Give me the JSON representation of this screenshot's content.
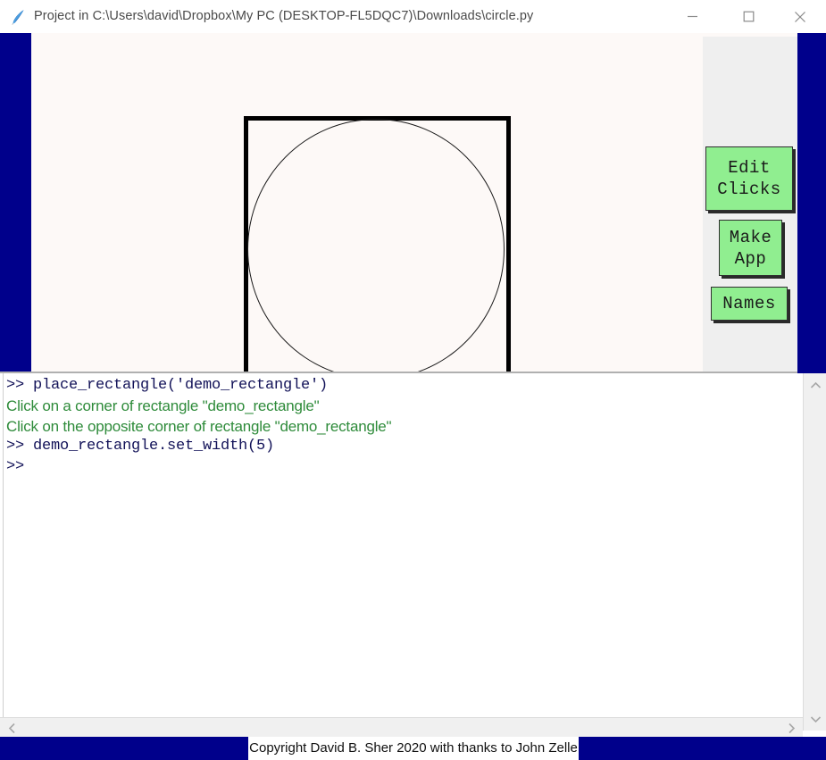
{
  "window": {
    "title": "Project in C:\\Users\\david\\Dropbox\\My PC (DESKTOP-FL5DQC7)\\Downloads\\circle.py",
    "app_icon": "python-feather-icon",
    "controls": {
      "minimize": "minimize-icon",
      "maximize": "maximize-icon",
      "close": "close-icon"
    }
  },
  "canvas": {
    "background_color": "#fdf9f7",
    "frame_color": "#00008b",
    "panel_color": "#efefef",
    "shapes": [
      {
        "name": "demo_rectangle",
        "type": "rectangle",
        "stroke_color": "#000000",
        "stroke_width": 5
      },
      {
        "name": "inscribed_circle",
        "type": "circle",
        "stroke_color": "#1a1a1a",
        "stroke_width": 1
      }
    ]
  },
  "side_panel": {
    "buttons": [
      {
        "label": "Edit\nClicks",
        "color": "#90ee90"
      },
      {
        "label": "Make\nApp",
        "color": "#90ee90"
      },
      {
        "label": "Names",
        "color": "#90ee90"
      }
    ]
  },
  "console": {
    "prompt": ">>",
    "lines": [
      {
        "kind": "code",
        "text": ">> place_rectangle('demo_rectangle')"
      },
      {
        "kind": "out",
        "text": "Click on a corner of rectangle \"demo_rectangle\""
      },
      {
        "kind": "out",
        "text": "Click on the opposite corner of rectangle \"demo_rectangle\""
      },
      {
        "kind": "code",
        "text": ">> demo_rectangle.set_width(5)"
      },
      {
        "kind": "code",
        "text": ">>"
      }
    ],
    "code_color": "#121258",
    "output_color": "#2e8b3a"
  },
  "scrollbars": {
    "vertical": {
      "up": "chevron-up-icon",
      "down": "chevron-down-icon"
    },
    "horizontal": {
      "left": "chevron-left-icon",
      "right": "chevron-right-icon"
    }
  },
  "status": {
    "copyright": "Copyright David B. Sher 2020 with thanks to John Zelle",
    "bar_color": "#00008b"
  }
}
